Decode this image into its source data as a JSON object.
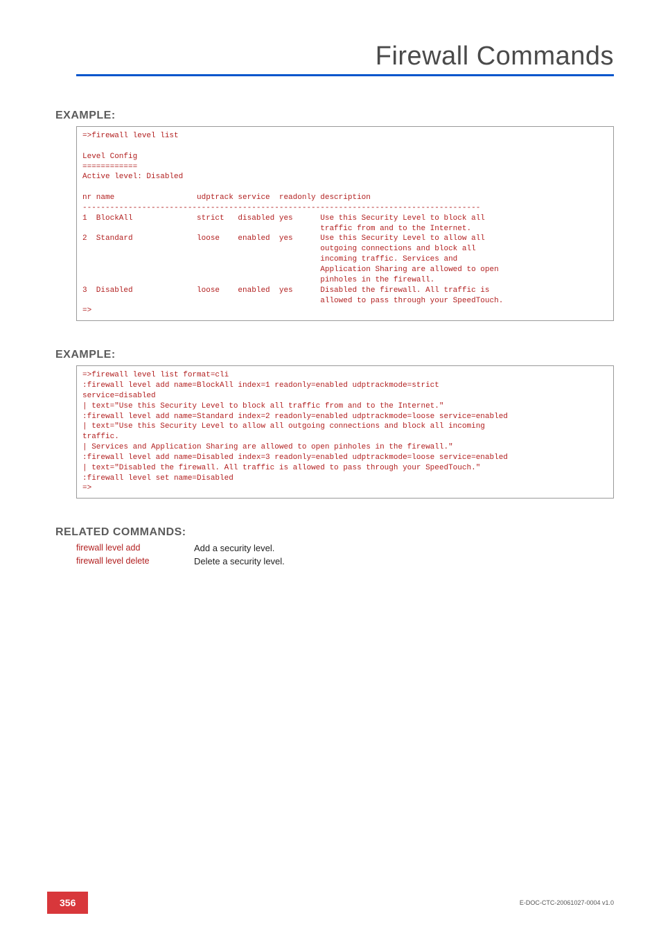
{
  "header": {
    "title": "Firewall Commands"
  },
  "sections": {
    "example1_label": "EXAMPLE:",
    "example2_label": "EXAMPLE:",
    "related_label": "RELATED COMMANDS:"
  },
  "code1": "=>firewall level list\n\nLevel Config\n============\nActive level: Disabled\n\nnr name                  udptrack service  readonly description\n---------------------------------------------------------------------------------------\n1  BlockAll              strict   disabled yes      Use this Security Level to block all\n                                                    traffic from and to the Internet.\n2  Standard              loose    enabled  yes      Use this Security Level to allow all\n                                                    outgoing connections and block all\n                                                    incoming traffic. Services and\n                                                    Application Sharing are allowed to open\n                                                    pinholes in the firewall.\n3  Disabled              loose    enabled  yes      Disabled the firewall. All traffic is\n                                                    allowed to pass through your SpeedTouch.\n=>",
  "code2": "=>firewall level list format=cli\n:firewall level add name=BlockAll index=1 readonly=enabled udptrackmode=strict\nservice=disabled\n| text=\"Use this Security Level to block all traffic from and to the Internet.\"\n:firewall level add name=Standard index=2 readonly=enabled udptrackmode=loose service=enabled\n| text=\"Use this Security Level to allow all outgoing connections and block all incoming\ntraffic.\n| Services and Application Sharing are allowed to open pinholes in the firewall.\"\n:firewall level add name=Disabled index=3 readonly=enabled udptrackmode=loose service=enabled\n| text=\"Disabled the firewall. All traffic is allowed to pass through your SpeedTouch.\"\n:firewall level set name=Disabled\n=>",
  "related": [
    {
      "cmd": "firewall level add",
      "desc": "Add a security level."
    },
    {
      "cmd": "firewall level delete",
      "desc": "Delete a security level."
    }
  ],
  "footer": {
    "page": "356",
    "docid": "E-DOC-CTC-20061027-0004 v1.0"
  }
}
